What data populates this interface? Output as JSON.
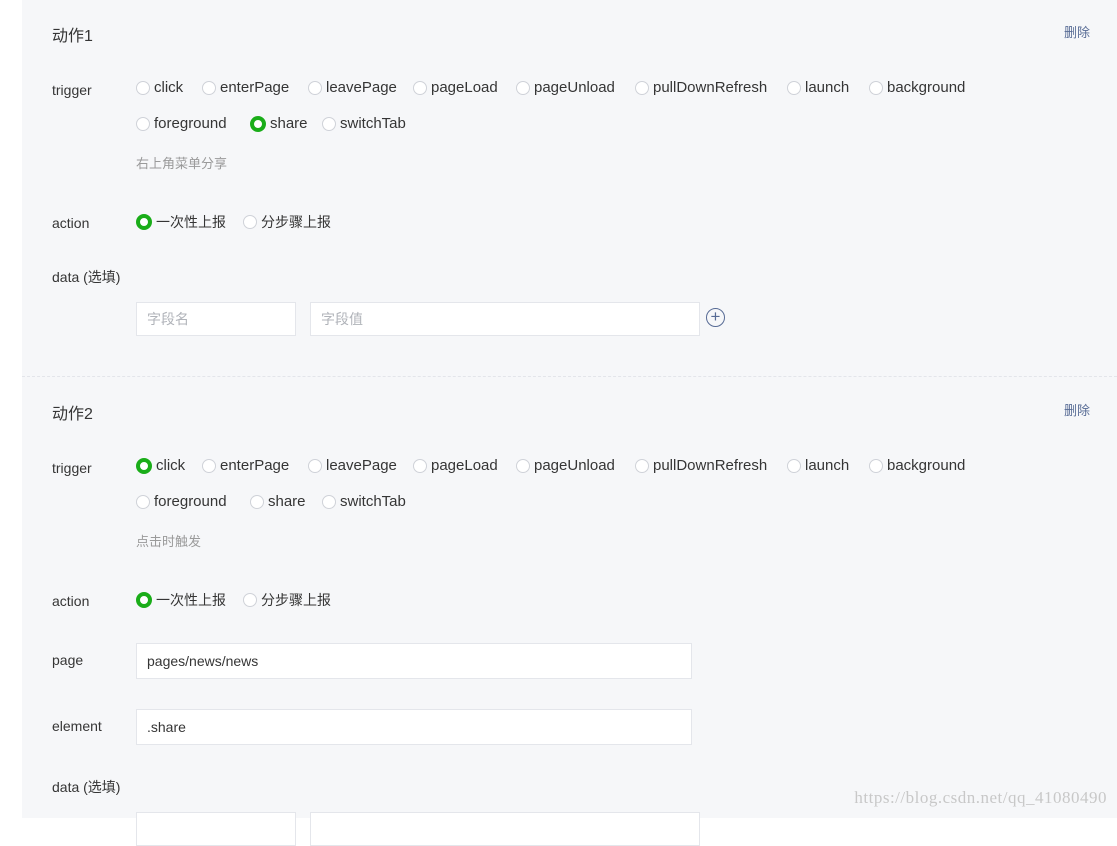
{
  "delete_label": "删除",
  "trigger_options": [
    "click",
    "enterPage",
    "leavePage",
    "pageLoad",
    "pageUnload",
    "pullDownRefresh",
    "launch",
    "background",
    "foreground",
    "share",
    "switchTab"
  ],
  "action_options": [
    "一次性上报",
    "分步骤上报"
  ],
  "labels": {
    "trigger": "trigger",
    "action": "action",
    "data": "data (选填)",
    "page": "page",
    "element": "element"
  },
  "placeholders": {
    "field_name": "字段名",
    "field_value": "字段值"
  },
  "actions": [
    {
      "title": "动作1",
      "selected_trigger": "share",
      "trigger_hint": "右上角菜单分享",
      "selected_action": "一次性上报"
    },
    {
      "title": "动作2",
      "selected_trigger": "click",
      "trigger_hint": "点击时触发",
      "selected_action": "一次性上报",
      "page_value": "pages/news/news",
      "element_value": ".share"
    }
  ],
  "watermark": "https://blog.csdn.net/qq_41080490",
  "colors": {
    "accent": "#1aad19",
    "link": "#576b95",
    "panel": "#f6f7f9"
  }
}
